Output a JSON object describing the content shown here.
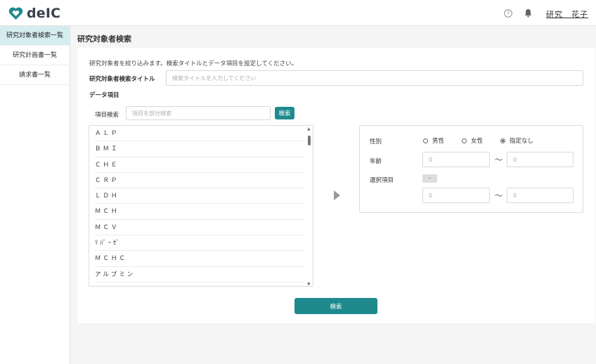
{
  "header": {
    "logo_text": "deIC",
    "user_name": "研究　花子",
    "brand_color": "#1f8a8e"
  },
  "sidebar": {
    "items": [
      {
        "label": "研究対象者検索一覧",
        "active": true
      },
      {
        "label": "研究計画書一覧",
        "active": false
      },
      {
        "label": "請求書一覧",
        "active": false
      }
    ]
  },
  "main": {
    "title": "研究対象者検索",
    "description": "研究対象者を絞り込みます。検索タイトルとデータ項目を設定してください。",
    "search_title_label": "研究対象者検索タイトル",
    "search_title_placeholder": "検索タイトルを入力してください",
    "data_items_label": "データ項目",
    "item_search_label": "項目検索",
    "item_search_placeholder": "項目を部分検索",
    "item_search_button": "検索",
    "items": [
      "ＡＬＰ",
      "ＢＭＩ",
      "ＣＨＥ",
      "ＣＲＰ",
      "ＬＤＨ",
      "ＭＣＨ",
      "ＭＣＶ",
      "ﾘﾊﾞｰｾﾞ",
      "ＭＣＨＣ",
      "アルブミン"
    ],
    "submit_button": "検索"
  },
  "criteria": {
    "gender_label": "性別",
    "gender_options": [
      "男性",
      "女性",
      "指定なし"
    ],
    "gender_selected": "指定なし",
    "age_label": "年齢",
    "age_from_placeholder": "0",
    "age_to_placeholder": "0",
    "tilde": "～",
    "selected_item_label": "選択項目",
    "selected_item_value": "-",
    "value_from_placeholder": "0",
    "value_to_placeholder": "0"
  }
}
